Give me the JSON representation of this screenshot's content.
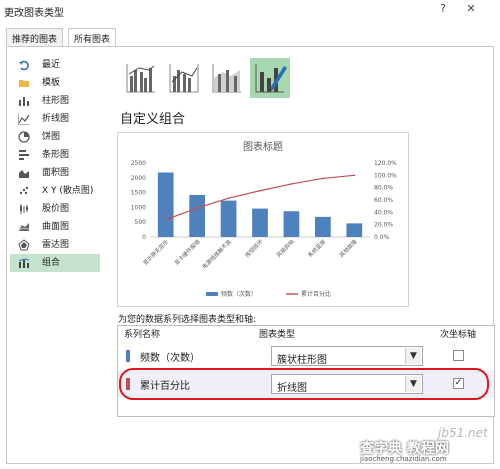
{
  "dialog": {
    "title": "更改图表类型",
    "help": "?",
    "close": "✕"
  },
  "tabs": [
    {
      "label": "推荐的图表"
    },
    {
      "label": "所有图表"
    }
  ],
  "sidebar": {
    "items": [
      {
        "label": "最近",
        "icon": "recent-icon"
      },
      {
        "label": "模板",
        "icon": "folder-icon"
      },
      {
        "label": "柱形图",
        "icon": "column-chart-icon"
      },
      {
        "label": "折线图",
        "icon": "line-chart-icon"
      },
      {
        "label": "饼图",
        "icon": "pie-chart-icon"
      },
      {
        "label": "条形图",
        "icon": "bar-chart-icon"
      },
      {
        "label": "面积图",
        "icon": "area-chart-icon"
      },
      {
        "label": "X Y (散点图)",
        "icon": "scatter-chart-icon"
      },
      {
        "label": "股价图",
        "icon": "stock-chart-icon"
      },
      {
        "label": "曲面图",
        "icon": "surface-chart-icon"
      },
      {
        "label": "雷达图",
        "icon": "radar-chart-icon"
      },
      {
        "label": "组合",
        "icon": "combo-chart-icon",
        "selected": true
      }
    ]
  },
  "subtypes": [
    {
      "icon": "clustered-column-line-icon"
    },
    {
      "icon": "clustered-column-line-secondary-icon"
    },
    {
      "icon": "stacked-area-column-icon"
    },
    {
      "icon": "custom-combination-icon",
      "selected": true
    }
  ],
  "main": {
    "heading": "自定义组合",
    "instruction": "为您的数据系列选择图表类型和轴:",
    "grid_headers": {
      "series": "系列名称",
      "type": "图表类型",
      "secondary": "次坐标轴"
    }
  },
  "series_rows": [
    {
      "name": "频数（次数）",
      "color": "#4f81bd",
      "chart_type": "簇状柱形图",
      "secondary": false
    },
    {
      "name": "累计百分比",
      "color": "#c0504d",
      "chart_type": "折线图",
      "secondary": true
    }
  ],
  "chart_data": {
    "type": "bar",
    "title": "图表标题",
    "categories": [
      "显示屏无显示",
      "显卡硬件报错",
      "电源线接触不良",
      "按钮损坏",
      "风扇异响",
      "系统蓝屏",
      "其他故障"
    ],
    "series": [
      {
        "name": "频数（次数）",
        "type": "bar",
        "axis": "primary",
        "color": "#4f81bd",
        "values": [
          2180,
          1420,
          1230,
          960,
          870,
          680,
          460
        ]
      },
      {
        "name": "累计百分比",
        "type": "line",
        "axis": "secondary",
        "color": "#c0504d",
        "values": [
          28,
          47,
          63,
          75,
          86,
          95,
          100
        ]
      }
    ],
    "y_ticks": [
      "0",
      "500",
      "1000",
      "1500",
      "2000",
      "2500"
    ],
    "y2_ticks": [
      "0.0%",
      "20.0%",
      "40.0%",
      "60.0%",
      "80.0%",
      "100.0%",
      "120.0%"
    ],
    "ylim": [
      0,
      2500
    ],
    "y2lim": [
      0,
      120
    ],
    "grid": false,
    "legend": "bottom"
  },
  "watermark": {
    "site": "jb51.net",
    "brand": "查字典 教程网",
    "url": "jiaocheng.chazidian.com"
  }
}
